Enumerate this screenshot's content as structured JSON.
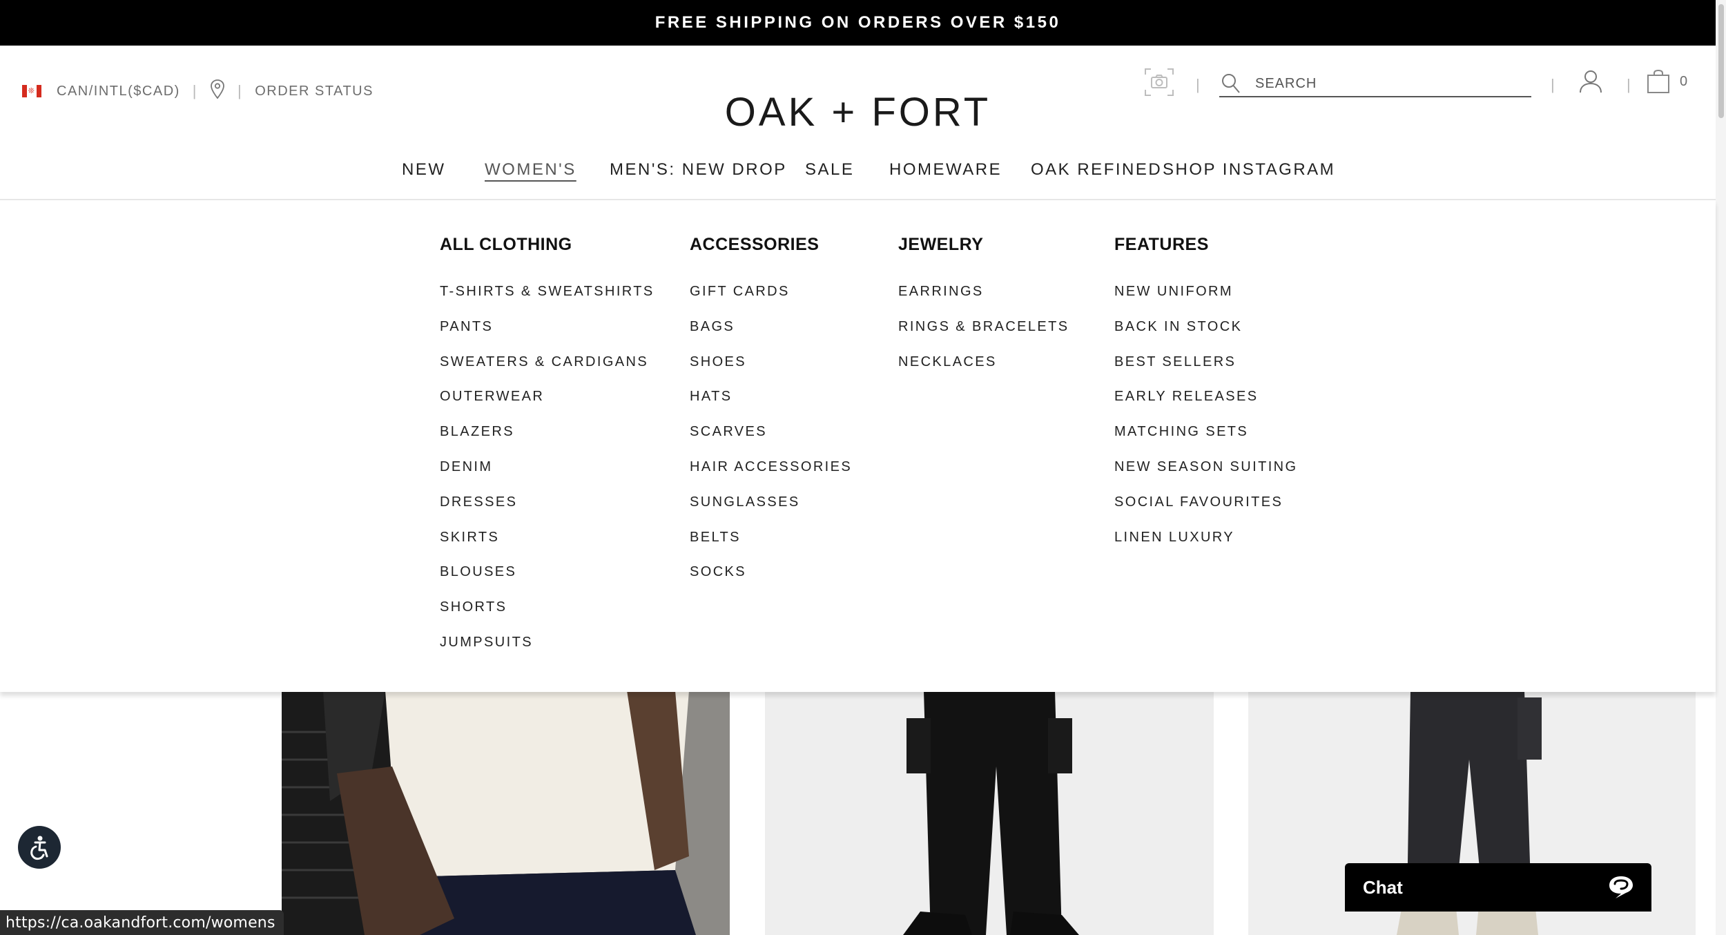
{
  "promo_banner": "FREE SHIPPING ON ORDERS OVER $150",
  "utility": {
    "region": "CAN/INTL($CAD)",
    "order_status": "ORDER STATUS"
  },
  "logo": "OAK + FORT",
  "search": {
    "placeholder": "SEARCH"
  },
  "cart": {
    "count": "0"
  },
  "nav": {
    "new": "NEW",
    "womens": "WOMEN'S",
    "mens": "MEN'S: NEW DROP",
    "sale": "SALE",
    "homeware": "HOMEWARE",
    "oak_refined": "OAK REFINED",
    "shop_instagram": "SHOP INSTAGRAM"
  },
  "mega_menu": {
    "clothing": {
      "heading": "ALL CLOTHING",
      "items": [
        "T-SHIRTS & SWEATSHIRTS",
        "PANTS",
        "SWEATERS & CARDIGANS",
        "OUTERWEAR",
        "BLAZERS",
        "DENIM",
        "DRESSES",
        "SKIRTS",
        "BLOUSES",
        "SHORTS",
        "JUMPSUITS"
      ]
    },
    "accessories": {
      "heading": "ACCESSORIES",
      "items": [
        "GIFT CARDS",
        "BAGS",
        "SHOES",
        "HATS",
        "SCARVES",
        "HAIR ACCESSORIES",
        "SUNGLASSES",
        "BELTS",
        "SOCKS"
      ]
    },
    "jewelry": {
      "heading": "JEWELRY",
      "items": [
        "EARRINGS",
        "RINGS & BRACELETS",
        "NECKLACES"
      ]
    },
    "features": {
      "heading": "FEATURES",
      "items": [
        "NEW UNIFORM",
        "BACK IN STOCK",
        "BEST SELLERS",
        "EARLY RELEASES",
        "MATCHING SETS",
        "NEW SEASON SUITING",
        "SOCIAL FAVOURITES",
        "LINEN LUXURY"
      ]
    }
  },
  "chat": {
    "label": "Chat"
  },
  "status_url": "https://ca.oakandfort.com/womens",
  "colors": {
    "banner_bg": "#000000",
    "flag_red": "#d52b1e",
    "text": "#222222",
    "muted": "#6d6d6d"
  }
}
